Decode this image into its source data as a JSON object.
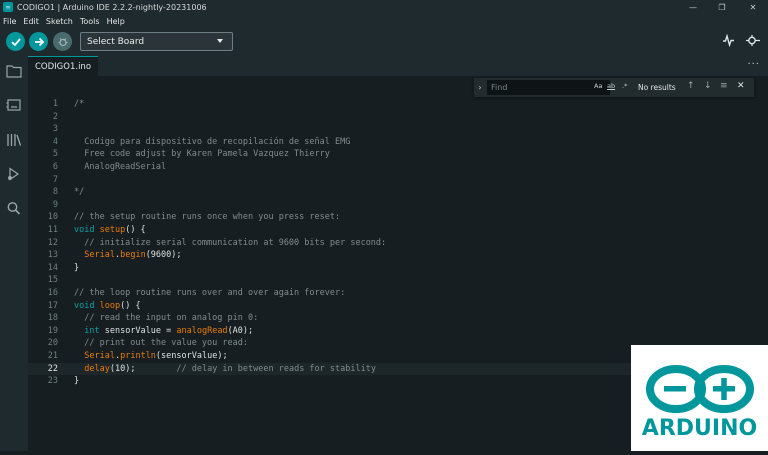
{
  "window": {
    "title": "CODIGO1 | Arduino IDE 2.2.2-nightly-20231006",
    "app_icon": "arduino-app-icon",
    "minimize_glyph": "—",
    "maximize_glyph": "❐",
    "close_glyph": "✕"
  },
  "menu": {
    "items": [
      "File",
      "Edit",
      "Sketch",
      "Tools",
      "Help"
    ]
  },
  "toolbar": {
    "verify_icon": "check-icon",
    "upload_icon": "arrow-right-icon",
    "debug_icon": "debug-icon",
    "board_selector": "Select Board",
    "serial_plotter_icon": "serial-plotter-icon",
    "serial_monitor_icon": "serial-monitor-icon"
  },
  "sidebar": {
    "items": [
      "sketchbook-icon",
      "boards-manager-icon",
      "library-manager-icon",
      "debug-panel-icon",
      "search-icon"
    ]
  },
  "tabs": {
    "active": "CODIGO1.ino",
    "more": "···"
  },
  "find": {
    "placeholder": "Find",
    "match_case": "Aa",
    "whole_word": "ab",
    "regex": ".*",
    "status": "No results",
    "prev_glyph": "↑",
    "next_glyph": "↓",
    "selection_glyph": "≡",
    "close_glyph": "✕",
    "toggle_glyph": "›"
  },
  "editor": {
    "current_line": 22,
    "lines": [
      {
        "n": "1",
        "tokens": [
          {
            "t": "/*",
            "c": "c"
          }
        ]
      },
      {
        "n": "2",
        "tokens": []
      },
      {
        "n": "3",
        "tokens": []
      },
      {
        "n": "4",
        "tokens": [
          {
            "t": "  Codigo para dispositivo de recopilación de señal EMG",
            "c": "c"
          }
        ]
      },
      {
        "n": "5",
        "tokens": [
          {
            "t": "  Free code adjust by Karen Pamela Vazquez Thierry",
            "c": "c"
          }
        ]
      },
      {
        "n": "6",
        "tokens": [
          {
            "t": "  AnalogReadSerial",
            "c": "c"
          }
        ]
      },
      {
        "n": "7",
        "tokens": []
      },
      {
        "n": "8",
        "tokens": [
          {
            "t": "*/",
            "c": "c"
          }
        ]
      },
      {
        "n": "9",
        "tokens": []
      },
      {
        "n": "10",
        "tokens": [
          {
            "t": "// the setup routine runs once when you press reset:",
            "c": "c"
          }
        ]
      },
      {
        "n": "11",
        "tokens": [
          {
            "t": "void",
            "c": "k"
          },
          {
            "t": " ",
            "c": "p"
          },
          {
            "t": "setup",
            "c": "f"
          },
          {
            "t": "() {",
            "c": "p"
          }
        ]
      },
      {
        "n": "12",
        "tokens": [
          {
            "t": "  // initialize serial communication at 9600 bits per second:",
            "c": "c"
          }
        ]
      },
      {
        "n": "13",
        "tokens": [
          {
            "t": "  ",
            "c": "p"
          },
          {
            "t": "Serial",
            "c": "f"
          },
          {
            "t": ".",
            "c": "p"
          },
          {
            "t": "begin",
            "c": "f"
          },
          {
            "t": "(9600);",
            "c": "p"
          }
        ]
      },
      {
        "n": "14",
        "tokens": [
          {
            "t": "}",
            "c": "p"
          }
        ]
      },
      {
        "n": "15",
        "tokens": []
      },
      {
        "n": "16",
        "tokens": [
          {
            "t": "// the loop routine runs over and over again forever:",
            "c": "c"
          }
        ]
      },
      {
        "n": "17",
        "tokens": [
          {
            "t": "void",
            "c": "k"
          },
          {
            "t": " ",
            "c": "p"
          },
          {
            "t": "loop",
            "c": "f"
          },
          {
            "t": "() {",
            "c": "p"
          }
        ]
      },
      {
        "n": "18",
        "tokens": [
          {
            "t": "  // read the input on analog pin 0:",
            "c": "c"
          }
        ]
      },
      {
        "n": "19",
        "tokens": [
          {
            "t": "  ",
            "c": "p"
          },
          {
            "t": "int",
            "c": "k"
          },
          {
            "t": " sensorValue = ",
            "c": "p"
          },
          {
            "t": "analogRead",
            "c": "f"
          },
          {
            "t": "(A0);",
            "c": "p"
          }
        ]
      },
      {
        "n": "20",
        "tokens": [
          {
            "t": "  // print out the value you read:",
            "c": "c"
          }
        ]
      },
      {
        "n": "21",
        "tokens": [
          {
            "t": "  ",
            "c": "p"
          },
          {
            "t": "Serial",
            "c": "f"
          },
          {
            "t": ".",
            "c": "p"
          },
          {
            "t": "println",
            "c": "f"
          },
          {
            "t": "(sensorValue);",
            "c": "p"
          }
        ]
      },
      {
        "n": "22",
        "tokens": [
          {
            "t": "  ",
            "c": "p"
          },
          {
            "t": "delay",
            "c": "f"
          },
          {
            "t": "(10);        ",
            "c": "p"
          },
          {
            "t": "// delay in between reads for stability",
            "c": "c"
          }
        ]
      },
      {
        "n": "23",
        "tokens": [
          {
            "t": "}",
            "c": "p"
          }
        ]
      }
    ]
  },
  "overlay": {
    "logo_text": "ARDUINO",
    "logo_color": "#00979c"
  },
  "colors": {
    "accent": "#00979c",
    "background": "#171e21",
    "chrome": "#1f2a2e"
  }
}
